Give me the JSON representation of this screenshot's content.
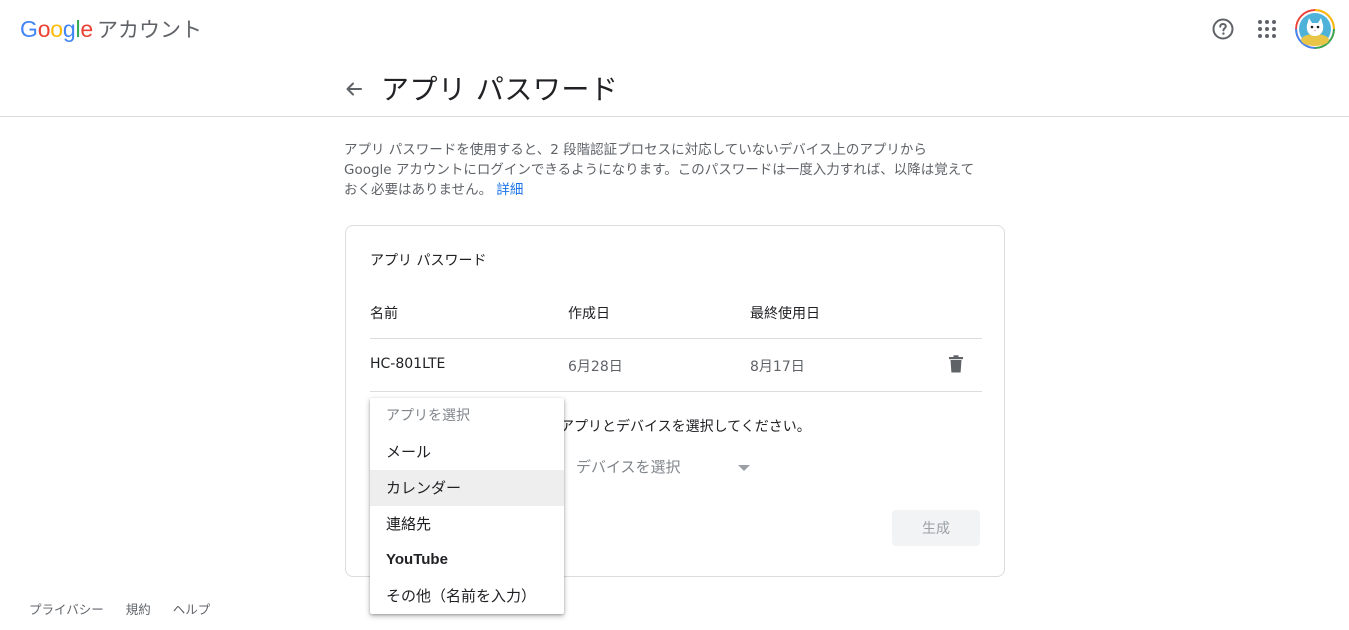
{
  "header": {
    "logo_letters": [
      "G",
      "o",
      "o",
      "g",
      "l",
      "e"
    ],
    "logo_colors": [
      "#4285F4",
      "#EA4335",
      "#FBBC05",
      "#4285F4",
      "#34A853",
      "#EA4335"
    ],
    "product": "アカウント",
    "icons": [
      "help-icon",
      "apps-grid-icon",
      "account-avatar"
    ]
  },
  "page": {
    "title": "アプリ パスワード",
    "description_1": "アプリ パスワードを使用すると、2 段階認証プロセスに対応していないデバイス上のアプリから",
    "description_2": "Google アカウントにログインできるようになります。このパスワードは一度入力すれば、以降は覚えて",
    "description_3": "おく必要はありません。",
    "learn_more": "詳細"
  },
  "card": {
    "title": "アプリ パスワード",
    "columns": {
      "name": "名前",
      "created": "作成日",
      "last_used": "最終使用日"
    },
    "rows": [
      {
        "name": "HC-801LTE",
        "created": "6月28日",
        "last_used": "8月17日"
      }
    ],
    "instruction": "アプリとデバイスを選択してください。",
    "device_placeholder": "デバイスを選択",
    "generate_button": "生成"
  },
  "app_menu": {
    "placeholder": "アプリを選択",
    "items": [
      "メール",
      "カレンダー",
      "連絡先",
      "YouTube",
      "その他（名前を入力）"
    ],
    "highlighted": "カレンダー"
  },
  "footer": {
    "links": [
      "プライバシー",
      "規約",
      "ヘルプ"
    ]
  },
  "colors": {
    "link": "#1a73e8",
    "divider": "#dadce0",
    "text_primary": "#202124",
    "text_secondary": "#5f6368"
  }
}
